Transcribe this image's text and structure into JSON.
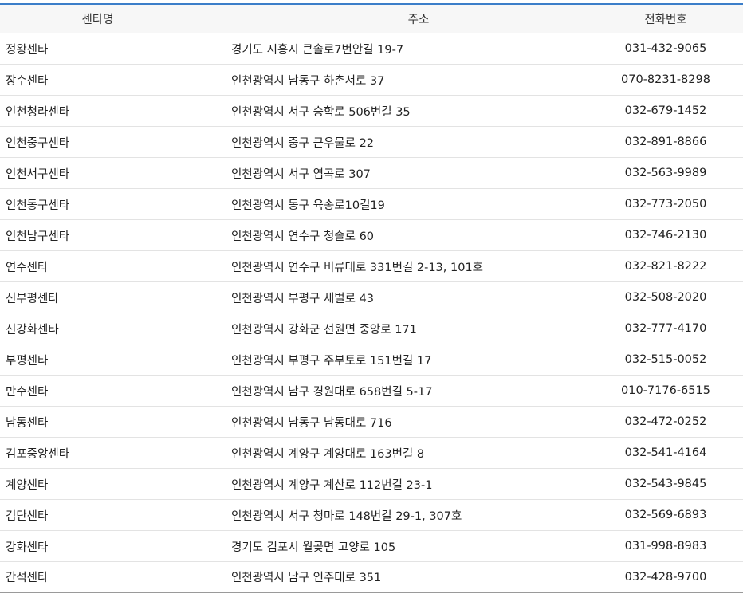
{
  "table": {
    "headers": {
      "name": "센타명",
      "address": "주소",
      "phone": "전화번호"
    },
    "rows": [
      {
        "name": "정왕센타",
        "address": "경기도 시흥시 큰솔로7번안길 19-7",
        "phone": "031-432-9065"
      },
      {
        "name": "장수센타",
        "address": "인천광역시 남동구 하촌서로 37",
        "phone": "070-8231-8298"
      },
      {
        "name": "인천청라센타",
        "address": "인천광역시 서구 승학로 506번길 35",
        "phone": "032-679-1452"
      },
      {
        "name": "인천중구센타",
        "address": "인천광역시 중구 큰우물로 22",
        "phone": "032-891-8866"
      },
      {
        "name": "인천서구센타",
        "address": "인천광역시 서구 염곡로 307",
        "phone": "032-563-9989"
      },
      {
        "name": "인천동구센타",
        "address": "인천광역시 동구 육송로10길19",
        "phone": "032-773-2050"
      },
      {
        "name": "인천남구센타",
        "address": "인천광역시 연수구 청솔로 60",
        "phone": "032-746-2130"
      },
      {
        "name": "연수센타",
        "address": "인천광역시 연수구 비류대로 331번길 2-13, 101호",
        "phone": "032-821-8222"
      },
      {
        "name": "신부평센타",
        "address": "인천광역시 부평구 새벌로 43",
        "phone": "032-508-2020"
      },
      {
        "name": "신강화센타",
        "address": "인천광역시 강화군 선원면 중앙로 171",
        "phone": "032-777-4170"
      },
      {
        "name": "부평센타",
        "address": "인천광역시 부평구 주부토로 151번길 17",
        "phone": "032-515-0052"
      },
      {
        "name": "만수센타",
        "address": "인천광역시 남구 경원대로 658번길 5-17",
        "phone": "010-7176-6515"
      },
      {
        "name": "남동센타",
        "address": "인천광역시 남동구 남동대로 716",
        "phone": "032-472-0252"
      },
      {
        "name": "김포중앙센타",
        "address": "인천광역시 계양구 계양대로 163번길 8",
        "phone": "032-541-4164"
      },
      {
        "name": "계양센타",
        "address": "인천광역시 계양구 계산로 112번길 23-1",
        "phone": "032-543-9845"
      },
      {
        "name": "검단센타",
        "address": "인천광역시 서구 청마로 148번길 29-1, 307호",
        "phone": "032-569-6893"
      },
      {
        "name": "강화센타",
        "address": "경기도 김포시 월곶면 고양로 105",
        "phone": "031-998-8983"
      },
      {
        "name": "간석센타",
        "address": "인천광역시 남구 인주대로 351",
        "phone": "032-428-9700"
      }
    ]
  }
}
